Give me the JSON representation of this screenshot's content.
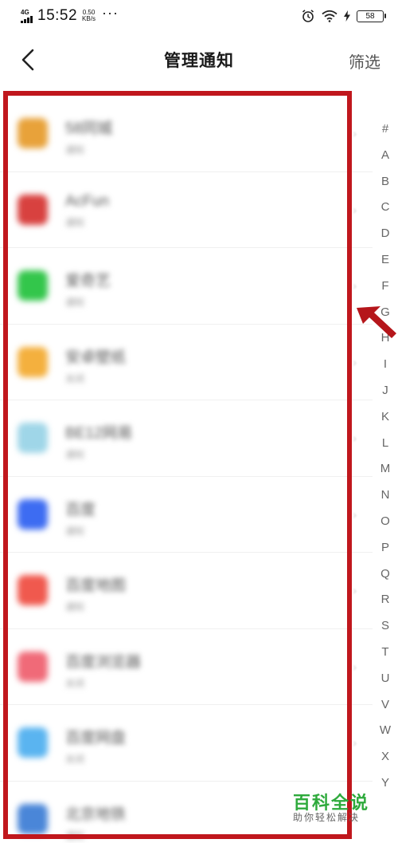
{
  "status_bar": {
    "network": "4G",
    "time": "15:52",
    "speed_value": "0.50",
    "speed_unit": "KB/s",
    "more": "···",
    "battery": "58"
  },
  "header": {
    "title": "管理通知",
    "filter_label": "筛选"
  },
  "apps": [
    {
      "name": "58同城",
      "status": "通知",
      "icon_color": "#e8a23a"
    },
    {
      "name": "AcFun",
      "status": "通知",
      "icon_color": "#d8413f"
    },
    {
      "name": "爱奇艺",
      "status": "通知",
      "icon_color": "#33c64b"
    },
    {
      "name": "安卓壁纸",
      "status": "关闭",
      "icon_color": "#f4b03e"
    },
    {
      "name": "BE12网易",
      "status": "通知",
      "icon_color": "#9fd6e8"
    },
    {
      "name": "百度",
      "status": "通知",
      "icon_color": "#3d6cf2"
    },
    {
      "name": "百度地图",
      "status": "通知",
      "icon_color": "#f0594e"
    },
    {
      "name": "百度浏览器",
      "status": "关闭",
      "icon_color": "#f06a78"
    },
    {
      "name": "百度网盘",
      "status": "关闭",
      "icon_color": "#5ab4f0"
    },
    {
      "name": "北京地铁",
      "status": "通知",
      "icon_color": "#4a86d8"
    }
  ],
  "alphabet": [
    "#",
    "A",
    "B",
    "C",
    "D",
    "E",
    "F",
    "G",
    "H",
    "I",
    "J",
    "K",
    "L",
    "M",
    "N",
    "O",
    "P",
    "Q",
    "R",
    "S",
    "T",
    "U",
    "V",
    "W",
    "X",
    "Y"
  ],
  "watermark": {
    "title": "百科全说",
    "subtitle": "助你轻松解决"
  },
  "colors": {
    "highlight": "#c0171d",
    "watermark_green": "#2eaa3c"
  }
}
